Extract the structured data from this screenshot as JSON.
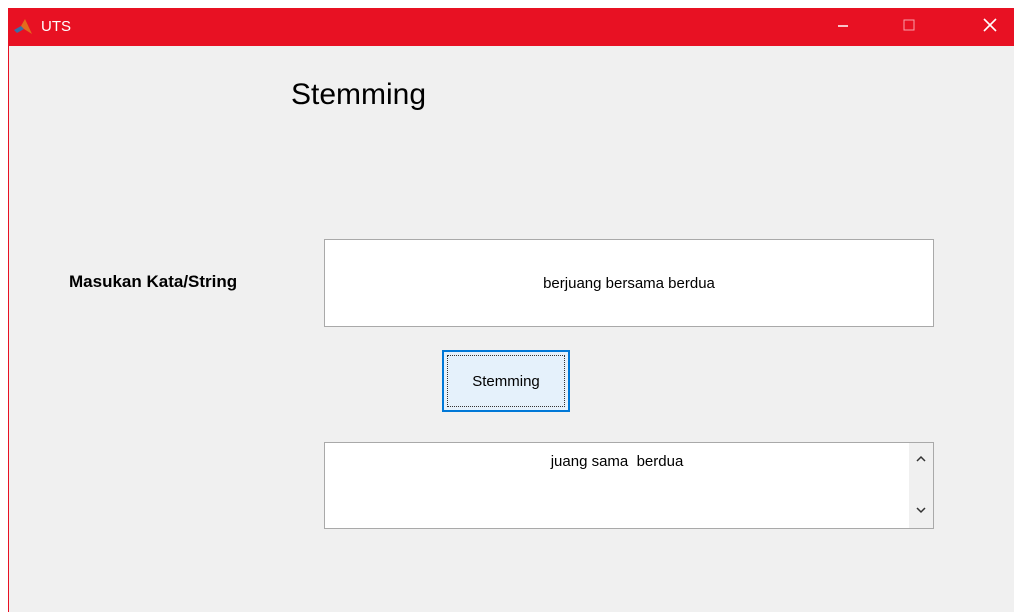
{
  "window": {
    "title": "UTS",
    "accent_color": "#e81123",
    "icon": "matlab-icon",
    "controls": [
      "minimize-icon",
      "maximize-icon",
      "close-icon"
    ]
  },
  "main": {
    "heading": "Stemming",
    "input_label": "Masukan Kata/String",
    "input_value": "berjuang bersama berdua",
    "button_label": "Stemming",
    "output_value": "juang sama  berdua",
    "output_scroll_icons": [
      "chevron-up-icon",
      "chevron-down-icon"
    ]
  }
}
